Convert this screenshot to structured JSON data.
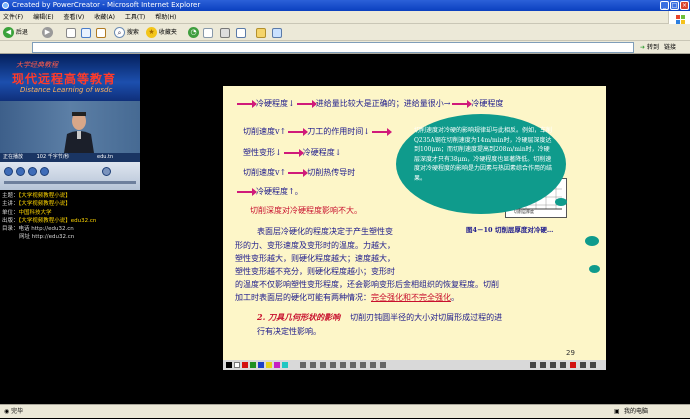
{
  "window": {
    "title": "Created by PowerCreator - Microsoft Internet Explorer"
  },
  "menu": {
    "items": [
      "文件(F)",
      "编辑(E)",
      "查看(V)",
      "收藏(A)",
      "工具(T)",
      "帮助(H)"
    ]
  },
  "toolbar": {
    "back": "后退",
    "search": "搜索",
    "favorites": "收藏夹"
  },
  "address": {
    "go_label": "转到",
    "links_label": "链接"
  },
  "video_header": {
    "line1": "大学经典教程",
    "line2": "现代远程高等教育",
    "line3": "Distance Learning of wsdc"
  },
  "video_caption": {
    "left": "正在播放",
    "mid": "102 千字节/秒",
    "right": "edu.tn"
  },
  "info": {
    "rows": [
      {
        "label": "主题：",
        "value": "【大学视频教程小说】"
      },
      {
        "label": "主讲：",
        "value": "【大学视频教程小说】"
      },
      {
        "label": "单位：",
        "value": "中国科技大学"
      },
      {
        "label": "出版：",
        "value": "【大学视频教程小说】edu32.cn"
      },
      {
        "label": "目录：",
        "value": "电话  http://edu32.cn"
      },
      {
        "label": "",
        "value": "网址  http://edu32.cn"
      }
    ]
  },
  "slide": {
    "line1": "冷硬程度↓",
    "line1b": "进给量比较大是正确的；进给量很小→",
    "line1c": "冷硬程度",
    "line2a": "切削速度v↑",
    "line2b": "刀工的作用时间↓",
    "line3a": "塑性变形↓",
    "line3b": "冷硬程度↓",
    "line4a": "切削速度v↑",
    "line4b": "切削热传导时",
    "line5": "冷硬程度↑。",
    "line6": "切削深度对冷硬程度影响不大。",
    "para1": "表面层冷硬化的程度决定于产生塑性变",
    "para2": "形的力、变形速度及变形时的温度。力越大，",
    "para3": "塑性变形越大，则硬化程度越大；速度越大，",
    "para4": "塑性变形越不充分，则硬化程度越小；变形时",
    "para5": "的温度不仅影响塑性变形程度，还会影响变形后金相组织的恢复程度。切削",
    "para6a": "加工时表面层的硬化可能有两种情况：",
    "para6b": "完全强化和不完全强化",
    "para6c": "。",
    "sec_title": "2. 刀具几何形状的影响",
    "sec_text": "切削刃钝圆半径的大小对切屑形成过程的进",
    "sec_text2": "行有决定性影响。",
    "callout": "切削速度对冷硬的影响规律却与此相反。例如，车削Q235A钢在切削速度为14m/min时，冷硬层深度达到100μm；而切削速度提高到208m/min时，冷硬层深度才只有38μm，冷硬程度也显著降低。切削速度对冷硬程度的影响是力因素与热因素综合作用的结果。",
    "figure_caption": "图4－10 切削层厚度对冷硬…",
    "graph_label": "切削层厚度",
    "page_number": "29"
  },
  "status": {
    "left": "完毕",
    "right": "我的电脑"
  }
}
